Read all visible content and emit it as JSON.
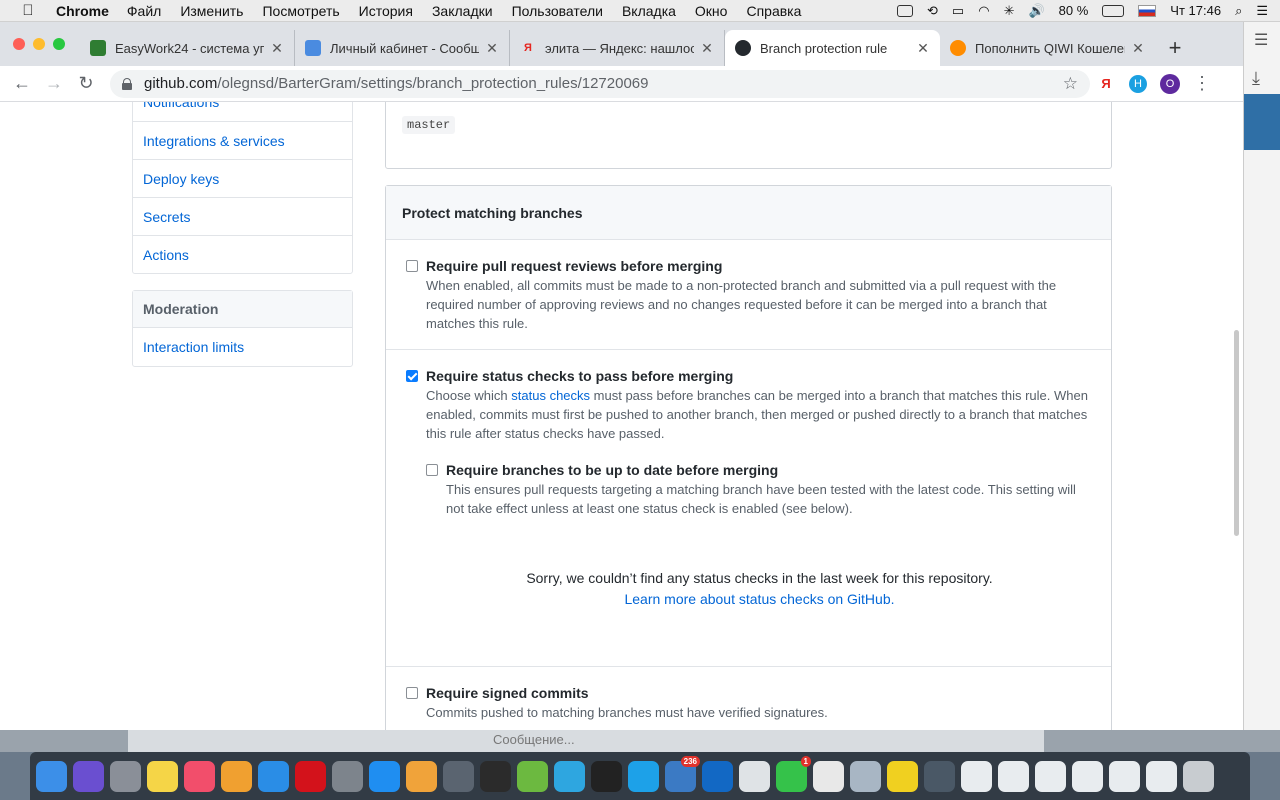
{
  "menubar": {
    "app": "Chrome",
    "items": [
      "Файл",
      "Изменить",
      "Посмотреть",
      "История",
      "Закладки",
      "Пользователи",
      "Вкладка",
      "Окно",
      "Справка"
    ],
    "battery": "80 %",
    "clock": "Чт 17:46"
  },
  "tabs": [
    {
      "title": "EasyWork24 - система уп",
      "icon_color": "#2f7d32"
    },
    {
      "title": "Личный кабинет - Сообщ",
      "icon_color": "#4a8be0"
    },
    {
      "title": "элита — Яндекс: нашлос",
      "icon_color": "#e52620",
      "icon_glyph": "Я"
    },
    {
      "title": "Branch protection rule",
      "icon_color": "#24292e"
    },
    {
      "title": "Пополнить QIWI Кошелек",
      "icon_color": "#ff8c00"
    }
  ],
  "address": {
    "host": "github.com",
    "path": "/olegnsd/BarterGram/settings/branch_protection_rules/12720069"
  },
  "extensions": {
    "yandex": "Я",
    "h": "H",
    "profile": "O"
  },
  "sidebar": {
    "top_items": [
      "Notifications",
      "Integrations & services",
      "Deploy keys",
      "Secrets",
      "Actions"
    ],
    "moderation_header": "Moderation",
    "moderation_items": [
      "Interaction limits"
    ]
  },
  "pattern": {
    "value": "master"
  },
  "protect": {
    "header": "Protect matching branches",
    "reviews": {
      "checked": false,
      "title": "Require pull request reviews before merging",
      "desc": "When enabled, all commits must be made to a non-protected branch and submitted via a pull request with the required number of approving reviews and no changes requested before it can be merged into a branch that matches this rule."
    },
    "status": {
      "checked": true,
      "title": "Require status checks to pass before merging",
      "desc_pre": "Choose which ",
      "desc_link": "status checks",
      "desc_post": " must pass before branches can be merged into a branch that matches this rule. When enabled, commits must first be pushed to another branch, then merged or pushed directly to a branch that matches this rule after status checks have passed.",
      "uptodate": {
        "checked": false,
        "title": "Require branches to be up to date before merging",
        "desc": "This ensures pull requests targeting a matching branch have been tested with the latest code. This setting will not take effect unless at least one status check is enabled (see below)."
      },
      "empty_text": "Sorry, we couldn’t find any status checks in the last week for this repository.",
      "empty_link": "Learn more about status checks on GitHub."
    },
    "signed": {
      "checked": false,
      "title": "Require signed commits",
      "desc": "Commits pushed to matching branches must have verified signatures."
    }
  },
  "chat_strip": {
    "placeholder": "Сообщение..."
  },
  "dock": {
    "apps": [
      {
        "name": "finder",
        "color": "#3c8fe8"
      },
      {
        "name": "siri",
        "color": "#6a4fd0"
      },
      {
        "name": "launchpad",
        "color": "#8a8f98"
      },
      {
        "name": "notes",
        "color": "#f5d547"
      },
      {
        "name": "music",
        "color": "#f24e6b"
      },
      {
        "name": "photos",
        "color": "#f0a030"
      },
      {
        "name": "safari",
        "color": "#2a8de6"
      },
      {
        "name": "opera",
        "color": "#d3121b"
      },
      {
        "name": "system-preferences",
        "color": "#7d848c"
      },
      {
        "name": "app-store",
        "color": "#1f8ef1"
      },
      {
        "name": "pages",
        "color": "#f0a33a"
      },
      {
        "name": "cleaner",
        "color": "#5a6470"
      },
      {
        "name": "ssh",
        "color": "#2b2b2b"
      },
      {
        "name": "utorrent",
        "color": "#6cb940"
      },
      {
        "name": "telegram",
        "color": "#2ea6e0"
      },
      {
        "name": "terminal",
        "color": "#222"
      },
      {
        "name": "skype",
        "color": "#1da1e8"
      },
      {
        "name": "mail",
        "color": "#3b7ac4",
        "badge": "236"
      },
      {
        "name": "teamviewer",
        "color": "#1268c4"
      },
      {
        "name": "chrome",
        "color": "#dfe3e6"
      },
      {
        "name": "whatsapp",
        "color": "#35c24a",
        "badge": "1"
      },
      {
        "name": "yandex-browser",
        "color": "#e8e8e8"
      },
      {
        "name": "preview",
        "color": "#a8b6c4"
      },
      {
        "name": "wunderlist",
        "color": "#f0d020"
      },
      {
        "name": "window-1",
        "color": "#4a5866"
      },
      {
        "name": "window-2",
        "color": "#e8ecef"
      },
      {
        "name": "window-3",
        "color": "#e8ecef"
      },
      {
        "name": "window-4",
        "color": "#e8ecef"
      },
      {
        "name": "window-5",
        "color": "#e8ecef"
      },
      {
        "name": "window-6",
        "color": "#e8ecef"
      },
      {
        "name": "window-7",
        "color": "#e8ecef"
      },
      {
        "name": "trash",
        "color": "#c8ccd0"
      }
    ]
  }
}
